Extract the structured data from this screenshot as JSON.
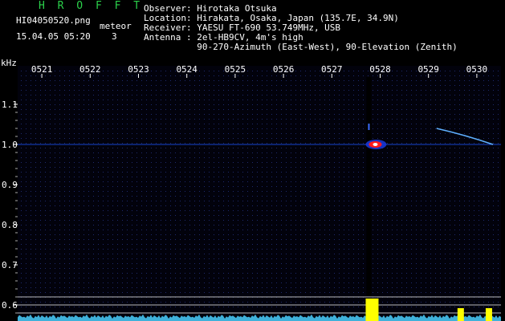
{
  "header": {
    "title": "H R O F F T",
    "filename": "HI04050520.png",
    "datetime": "15.04.05 05:20",
    "count_label": "meteor",
    "count_value": "3",
    "info": [
      {
        "key": "Observer ",
        "value": ": Hirotaka Otsuka"
      },
      {
        "key": "Location ",
        "value": ": Hirakata, Osaka, Japan (135.7E, 34.9N)"
      },
      {
        "key": "Receiver ",
        "value": ": YAESU FT-690 53.749MHz, USB"
      },
      {
        "key": "Antenna  ",
        "value": ": 2el-HB9CV, 4m's high"
      },
      {
        "key": "",
        "value": "  90-270-Azimuth (East-West), 90-Elevation (Zenith)"
      }
    ]
  },
  "colors": {
    "background": "#000000",
    "header_green": "#2bd14b",
    "grid_dot": "#1e2a6e",
    "baseline": "#1a55ff",
    "power_cyan": "#4ad0ff",
    "power_yellow": "#ffff00",
    "ref_line": "#bbbbbb"
  },
  "chart_data": {
    "type": "heatmap",
    "ylabel": "kHz",
    "x_ticks": [
      "0521",
      "0522",
      "0523",
      "0524",
      "0525",
      "0526",
      "0527",
      "0528",
      "0529",
      "0530"
    ],
    "y_ticks": [
      "1.1",
      "1.0",
      "0.9",
      "0.8",
      "0.7",
      "0.6"
    ],
    "xlim": [
      "05:20:30",
      "05:30:30"
    ],
    "ylim": [
      0.59,
      1.15
    ],
    "carrier_khz": 1.0,
    "meteor_echoes": [
      {
        "type": "head echo",
        "time": "05:27:50",
        "freq_khz": 1.0,
        "intensity": "strong"
      },
      {
        "type": "faint",
        "time": "05:27:45",
        "freq_khz": 1.05,
        "intensity": "faint"
      },
      {
        "type": "doppler trail",
        "time_start": "05:29:10",
        "time_end": "05:30:20",
        "freq_start_khz": 1.04,
        "freq_end_khz": 1.0,
        "intensity": "medium"
      }
    ],
    "power_bursts": [
      {
        "time": "05:27:50",
        "level": "high"
      },
      {
        "time": "05:29:40",
        "level": "medium"
      },
      {
        "time": "05:30:15",
        "level": "medium"
      }
    ],
    "reference_lines": 3
  }
}
